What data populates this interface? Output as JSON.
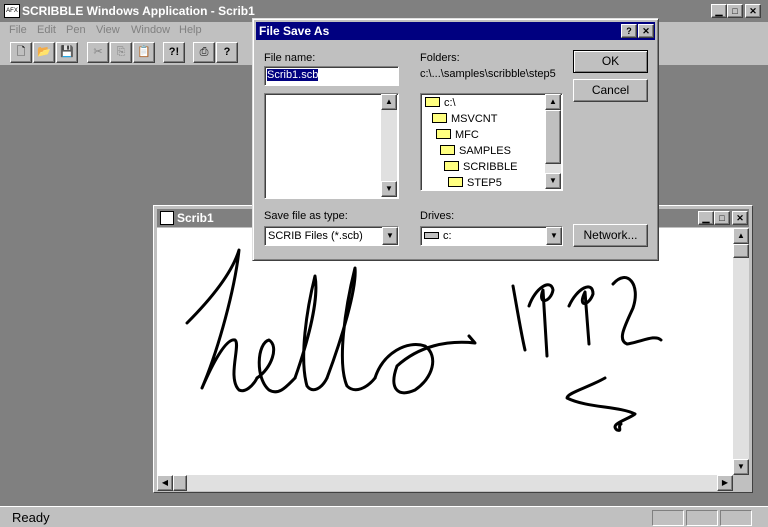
{
  "app": {
    "title": "SCRIBBLE Windows Application - Scrib1",
    "logo_text": "AFX",
    "menu": [
      "File",
      "Edit",
      "Pen",
      "View",
      "Window",
      "Help"
    ],
    "status": "Ready",
    "controls": {
      "minimize": "▁",
      "maximize": "□",
      "close": "✕"
    }
  },
  "toolbar": {
    "buttons": [
      {
        "icon": "new-file-icon",
        "glyph": "🗋"
      },
      {
        "icon": "open-folder-icon",
        "glyph": "📂"
      },
      {
        "icon": "save-disk-icon",
        "glyph": "💾"
      },
      {
        "icon": "cut-scissors-icon",
        "glyph": "✂"
      },
      {
        "icon": "copy-icon",
        "glyph": "⎘"
      },
      {
        "icon": "paste-clipboard-icon",
        "glyph": "📋"
      },
      {
        "icon": "context-help-icon",
        "glyph": "?!"
      },
      {
        "icon": "print-icon",
        "glyph": "⎙"
      },
      {
        "icon": "about-help-icon",
        "glyph": "?"
      }
    ]
  },
  "doc": {
    "title": "Scrib1",
    "controls": {
      "minimize": "▁",
      "maximize": "□",
      "close": "✕"
    },
    "scroll": {
      "up": "▲",
      "down": "▼",
      "left": "◀",
      "right": "▶"
    }
  },
  "dialog": {
    "title": "File Save As",
    "controls": {
      "help": "?",
      "close": "✕"
    },
    "file_name_label": "File name:",
    "file_name_value": "Scrib1.scb",
    "folders_label": "Folders:",
    "current_path": "c:\\...\\samples\\scribble\\step5",
    "folders": [
      "c:\\",
      "MSVCNT",
      "MFC",
      "SAMPLES",
      "SCRIBBLE",
      "STEP5"
    ],
    "save_type_label": "Save file as type:",
    "save_type_value": "SCRIB Files (*.scb)",
    "drives_label": "Drives:",
    "drive_value": "c:",
    "ok": "OK",
    "cancel": "Cancel",
    "network": "Network...",
    "scroll": {
      "up": "▲",
      "down": "▼"
    },
    "combo_arrow": "▼"
  },
  "colors": {
    "active_caption": "#000080",
    "inactive_caption": "#808080",
    "face": "#c0c0c0",
    "workspace": "#808080"
  }
}
